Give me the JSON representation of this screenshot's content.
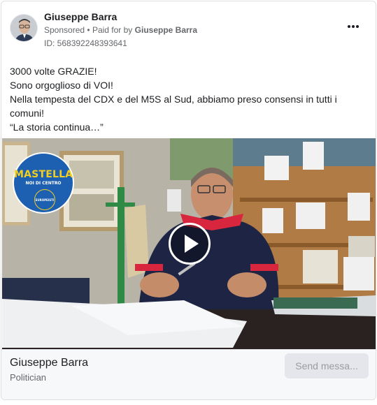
{
  "post": {
    "author": "Giuseppe Barra",
    "sponsored": "Sponsored",
    "separator": "•",
    "paid_for_prefix": "Paid for by",
    "paid_for_name": "Giuseppe Barra",
    "id_text": "ID: 568392248393641",
    "body_lines": [
      "3000 volte GRAZIE!",
      "Sono orgoglioso di VOI!",
      "Nella tempesta del CDX e del M5S al Sud, abbiamo preso consensi in tutti i",
      "comuni!",
      "“La storia continua…”"
    ]
  },
  "video": {
    "logo_line1": "MASTELLA",
    "logo_line2": "NOI DI CENTRO",
    "logo_line3": "EUROPEISTI",
    "play_icon": "play-icon"
  },
  "footer": {
    "page_name": "Giuseppe Barra",
    "page_category": "Politician",
    "cta_label": "Send messa..."
  },
  "icons": {
    "more": "more-horizontal-icon"
  },
  "colors": {
    "text_primary": "#1c1e21",
    "text_secondary": "#65676b",
    "button_bg": "#e4e6eb",
    "logo_blue": "#1d5fb1",
    "logo_yellow": "#f2cf1f"
  }
}
